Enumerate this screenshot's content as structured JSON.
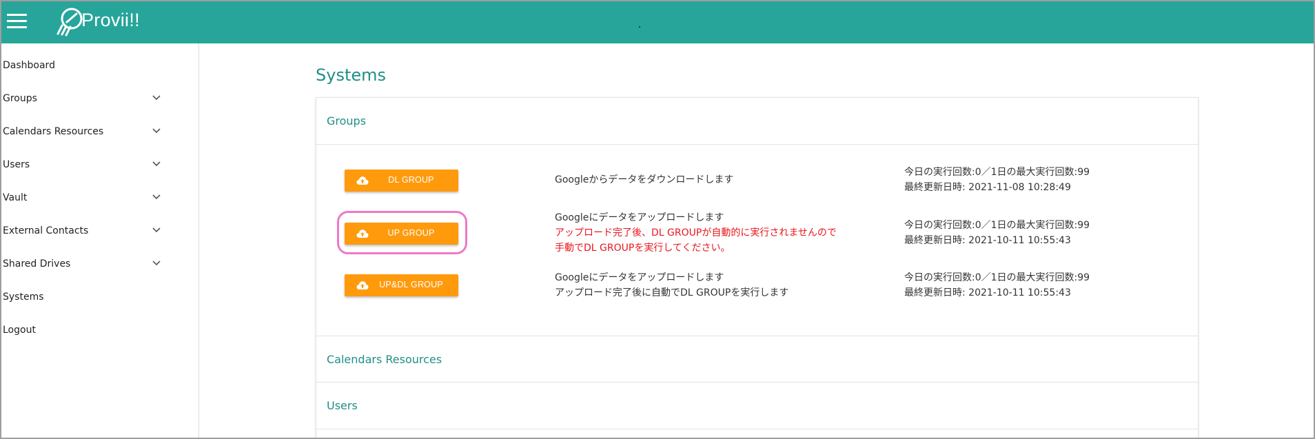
{
  "header": {
    "brand": "Provii!!",
    "menu_icon": "hamburger-menu-icon",
    "logo_icon": "provii-logo-icon",
    "background_color": "#27a59b"
  },
  "sidebar": {
    "items": [
      {
        "label": "Dashboard",
        "expandable": false
      },
      {
        "label": "Groups",
        "expandable": true
      },
      {
        "label": "Calendars Resources",
        "expandable": true
      },
      {
        "label": "Users",
        "expandable": true
      },
      {
        "label": "Vault",
        "expandable": true
      },
      {
        "label": "External Contacts",
        "expandable": true
      },
      {
        "label": "Shared Drives",
        "expandable": true
      },
      {
        "label": "Systems",
        "expandable": false
      },
      {
        "label": "Logout",
        "expandable": false
      }
    ]
  },
  "main": {
    "title": "Systems",
    "sections": [
      {
        "label": "Groups"
      },
      {
        "label": "Calendars Resources"
      },
      {
        "label": "Users"
      }
    ],
    "groups_rows": [
      {
        "button": "DL GROUP",
        "description": [
          "Googleからデータをダウンロードします"
        ],
        "warning": [],
        "run_count": "今日の実行回数:0／1日の最大実行回数:99",
        "last_updated": "最終更新日時: 2021-11-08 10:28:49"
      },
      {
        "button": "UP GROUP",
        "description": [
          "Googleにデータをアップロードします"
        ],
        "warning": [
          "アップロード完了後、DL GROUPが自動的に実行されませんので",
          "手動でDL GROUPを実行してください。"
        ],
        "run_count": "今日の実行回数:0／1日の最大実行回数:99",
        "last_updated": "最終更新日時: 2021-10-11 10:55:43"
      },
      {
        "button": "UP&DL GROUP",
        "description": [
          "Googleにデータをアップロードします",
          "アップロード完了後に自動でDL GROUPを実行します"
        ],
        "warning": [],
        "run_count": "今日の実行回数:0／1日の最大実行回数:99",
        "last_updated": "最終更新日時: 2021-10-11 10:55:43"
      }
    ],
    "button_icon": "cloud-upload-icon",
    "colors": {
      "accent": "#1f8f87",
      "button": "#ff9a0d",
      "warning": "#e8161c",
      "highlight": "#ef78c6"
    }
  }
}
